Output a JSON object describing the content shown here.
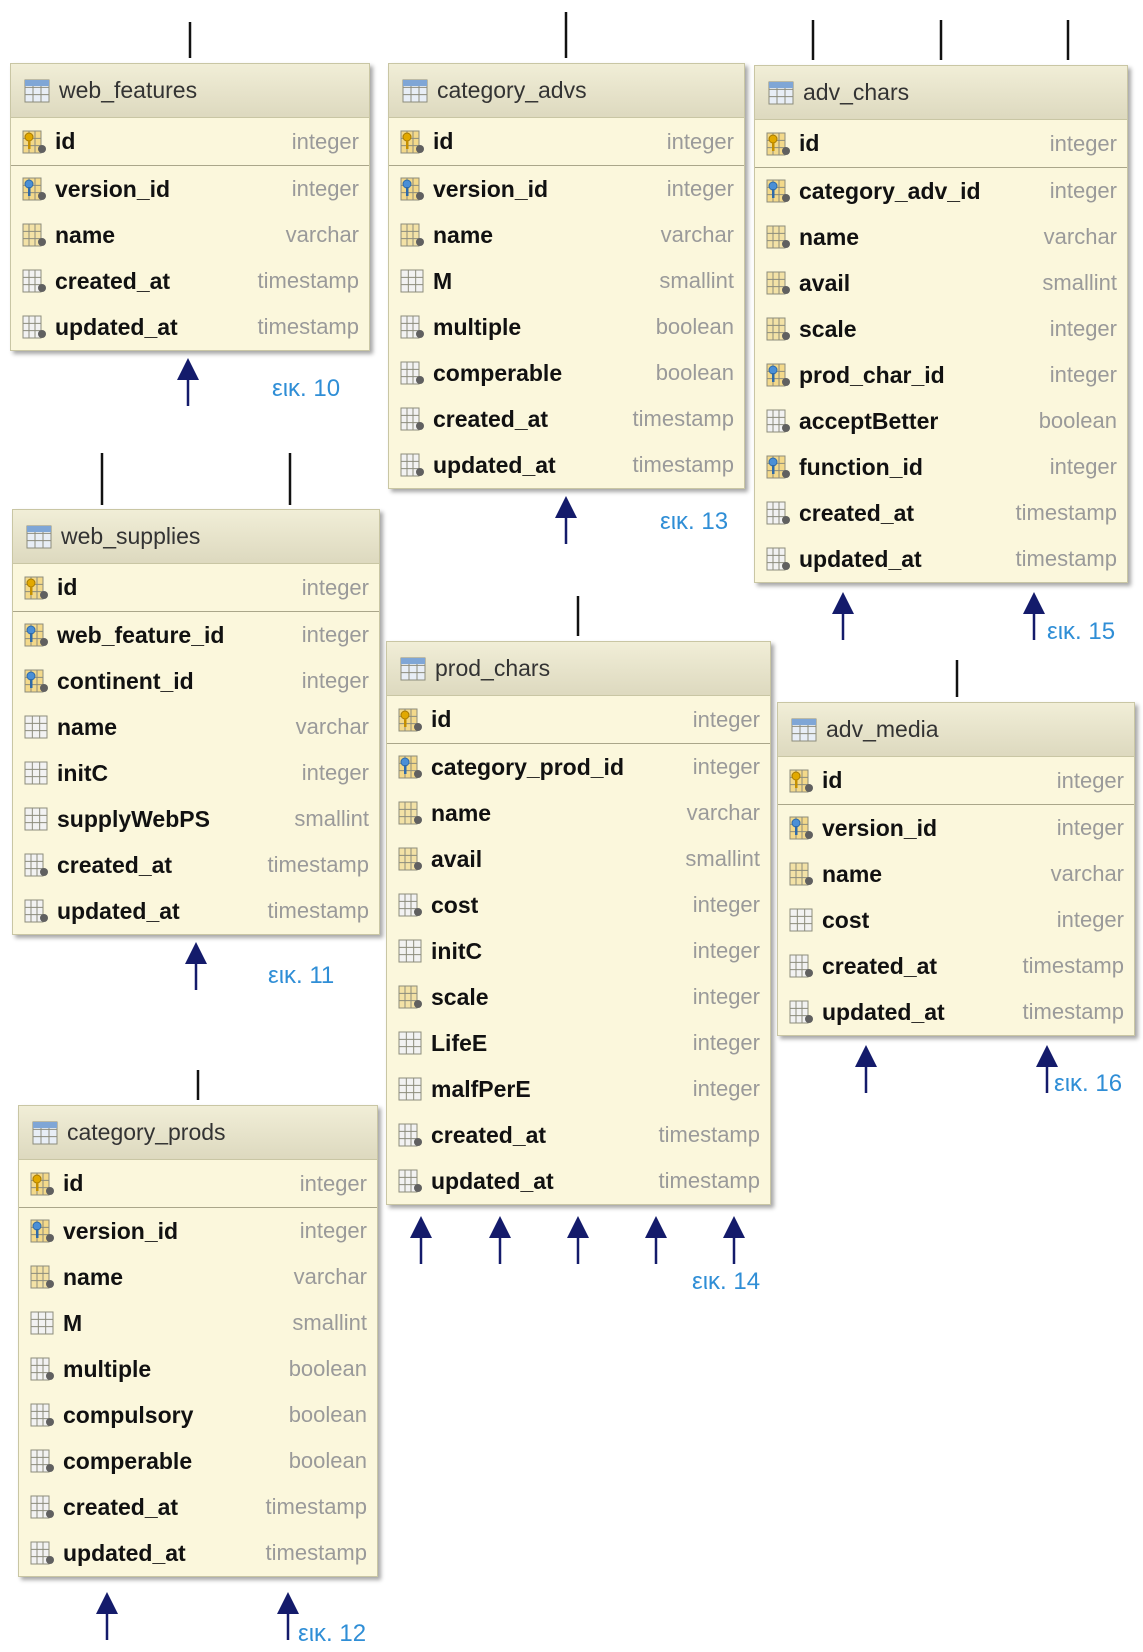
{
  "tables": [
    {
      "name": "web_features",
      "cols": [
        [
          "id",
          "integer",
          "pk"
        ],
        [
          "version_id",
          "integer",
          "fk"
        ],
        [
          "name",
          "varchar",
          "idx"
        ],
        [
          "created_at",
          "timestamp",
          "col"
        ],
        [
          "updated_at",
          "timestamp",
          "col"
        ]
      ]
    },
    {
      "name": "category_advs",
      "cols": [
        [
          "id",
          "integer",
          "pk"
        ],
        [
          "version_id",
          "integer",
          "fk"
        ],
        [
          "name",
          "varchar",
          "idx"
        ],
        [
          "M",
          "smallint",
          "plain"
        ],
        [
          "multiple",
          "boolean",
          "col"
        ],
        [
          "comperable",
          "boolean",
          "col"
        ],
        [
          "created_at",
          "timestamp",
          "col"
        ],
        [
          "updated_at",
          "timestamp",
          "col"
        ]
      ]
    },
    {
      "name": "adv_chars",
      "cols": [
        [
          "id",
          "integer",
          "pk"
        ],
        [
          "category_adv_id",
          "integer",
          "fk"
        ],
        [
          "name",
          "varchar",
          "idx"
        ],
        [
          "avail",
          "smallint",
          "idx"
        ],
        [
          "scale",
          "integer",
          "idx"
        ],
        [
          "prod_char_id",
          "integer",
          "fk"
        ],
        [
          "acceptBetter",
          "boolean",
          "col"
        ],
        [
          "function_id",
          "integer",
          "fk"
        ],
        [
          "created_at",
          "timestamp",
          "col"
        ],
        [
          "updated_at",
          "timestamp",
          "col"
        ]
      ]
    },
    {
      "name": "web_supplies",
      "cols": [
        [
          "id",
          "integer",
          "pk"
        ],
        [
          "web_feature_id",
          "integer",
          "fk"
        ],
        [
          "continent_id",
          "integer",
          "fk"
        ],
        [
          "name",
          "varchar",
          "plain"
        ],
        [
          "initC",
          "integer",
          "plain"
        ],
        [
          "supplyWebPS",
          "smallint",
          "plain"
        ],
        [
          "created_at",
          "timestamp",
          "col"
        ],
        [
          "updated_at",
          "timestamp",
          "col"
        ]
      ]
    },
    {
      "name": "prod_chars",
      "cols": [
        [
          "id",
          "integer",
          "pk"
        ],
        [
          "category_prod_id",
          "integer",
          "fk"
        ],
        [
          "name",
          "varchar",
          "idx"
        ],
        [
          "avail",
          "smallint",
          "idx"
        ],
        [
          "cost",
          "integer",
          "col"
        ],
        [
          "initC",
          "integer",
          "plain"
        ],
        [
          "scale",
          "integer",
          "idx"
        ],
        [
          "LifeE",
          "integer",
          "plain"
        ],
        [
          "malfPerE",
          "integer",
          "plain"
        ],
        [
          "created_at",
          "timestamp",
          "col"
        ],
        [
          "updated_at",
          "timestamp",
          "col"
        ]
      ]
    },
    {
      "name": "adv_media",
      "cols": [
        [
          "id",
          "integer",
          "pk"
        ],
        [
          "version_id",
          "integer",
          "fk"
        ],
        [
          "name",
          "varchar",
          "idx"
        ],
        [
          "cost",
          "integer",
          "plain"
        ],
        [
          "created_at",
          "timestamp",
          "col"
        ],
        [
          "updated_at",
          "timestamp",
          "col"
        ]
      ]
    },
    {
      "name": "category_prods",
      "cols": [
        [
          "id",
          "integer",
          "pk"
        ],
        [
          "version_id",
          "integer",
          "fk"
        ],
        [
          "name",
          "varchar",
          "idx"
        ],
        [
          "M",
          "smallint",
          "plain"
        ],
        [
          "multiple",
          "boolean",
          "col"
        ],
        [
          "compulsory",
          "boolean",
          "col"
        ],
        [
          "comperable",
          "boolean",
          "col"
        ],
        [
          "created_at",
          "timestamp",
          "col"
        ],
        [
          "updated_at",
          "timestamp",
          "col"
        ]
      ]
    }
  ],
  "captions": [
    "εικ. 10",
    "εικ. 11",
    "εικ. 12",
    "εικ. 13",
    "εικ. 14",
    "εικ. 15",
    "εικ. 16"
  ]
}
